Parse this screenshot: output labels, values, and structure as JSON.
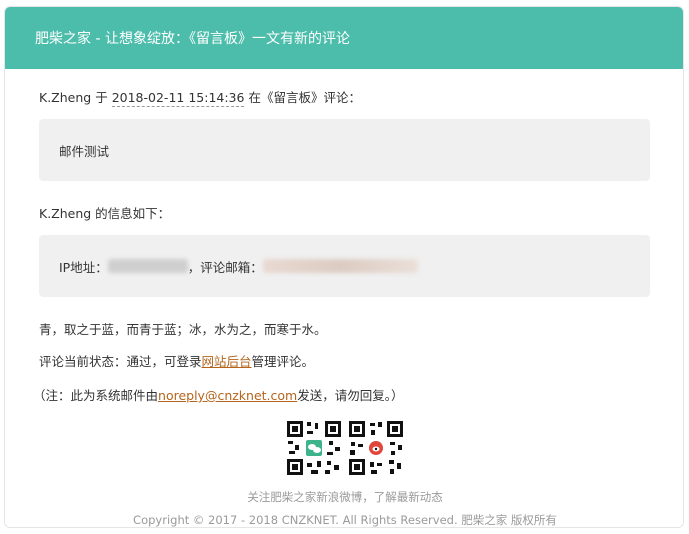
{
  "header": {
    "title": "肥柴之家 - 让想象绽放：《留言板》一文有新的评论"
  },
  "comment": {
    "author": "K.Zheng",
    "prefix": "于",
    "date": "2018-02-11 15:14:36",
    "middle": "在《留言板》评论：",
    "text": "邮件测试"
  },
  "info": {
    "heading": "K.Zheng 的信息如下：",
    "ip_label": "IP地址：",
    "email_label": "，评论邮箱："
  },
  "quote": "青，取之于蓝，而青于蓝；冰，水为之，而寒于水。",
  "status": {
    "before": "评论当前状态：通过，可登录",
    "link": "网站后台",
    "after": "管理评论。"
  },
  "note": {
    "before": "（注：此为系统邮件由",
    "link": "noreply@cnzknet.com",
    "after": "发送，请勿回复。）"
  },
  "footer": {
    "follow": "关注肥柴之家新浪微博，了解最新动态",
    "copyright": "Copyright © 2017 - 2018 CNZKNET. All Rights Reserved. 肥柴之家 版权所有"
  },
  "colors": {
    "header_bg": "#4dbdab",
    "link": "#b5651d",
    "box_bg": "#f0f0f0"
  },
  "icons": {
    "qr_left": "wechat-qr-icon",
    "qr_right": "weibo-qr-icon"
  }
}
